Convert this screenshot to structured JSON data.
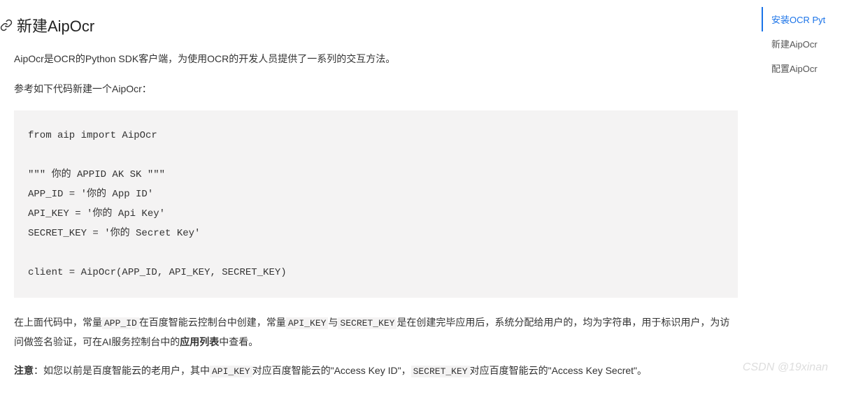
{
  "section": {
    "title": "新建AipOcr",
    "intro": "AipOcr是OCR的Python SDK客户端，为使用OCR的开发人员提供了一系列的交互方法。",
    "ref_line": "参考如下代码新建一个AipOcr：",
    "code": "from aip import AipOcr\n\n\"\"\" 你的 APPID AK SK \"\"\"\nAPP_ID = '你的 App ID'\nAPI_KEY = '你的 Api Key'\nSECRET_KEY = '你的 Secret Key'\n\nclient = AipOcr(APP_ID, API_KEY, SECRET_KEY)",
    "desc": {
      "p1_a": "在上面代码中，常量",
      "code1": "APP_ID",
      "p1_b": "在百度智能云控制台中创建，常量",
      "code2": "API_KEY",
      "p1_c": "与",
      "code3": "SECRET_KEY",
      "p1_d": "是在创建完毕应用后，系统分配给用户的，均为字符串，用于标识用户，为访问做签名验证，可在AI服务控制台中的",
      "bold1": "应用列表",
      "p1_e": "中查看。"
    },
    "note": {
      "label": "注意",
      "a": "：如您以前是百度智能云的老用户，其中",
      "code1": "API_KEY",
      "b": "对应百度智能云的\"Access Key ID\"，",
      "code2": "SECRET_KEY",
      "c": "对应百度智能云的\"Access Key Secret\"。"
    }
  },
  "sidebar": {
    "items": [
      {
        "label": "安装OCR Pyt",
        "active": true
      },
      {
        "label": "新建AipOcr",
        "active": false
      },
      {
        "label": "配置AipOcr",
        "active": false
      }
    ]
  },
  "watermark": "CSDN @19xinan"
}
